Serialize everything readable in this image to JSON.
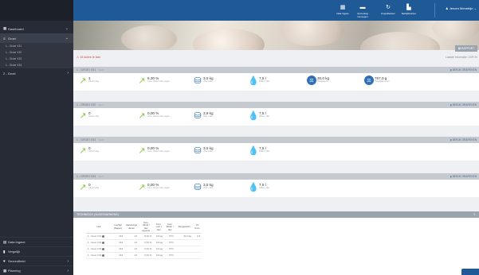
{
  "sidebar": {
    "main_items": [
      {
        "label": "Dashboard",
        "icon": "grid-icon"
      },
      {
        "label": "Groei",
        "icon": "list-icon"
      }
    ],
    "sub_items": [
      "1 - Groei V31",
      "1 - Groei V32",
      "1 - Groei V33",
      "1 - Groei V34"
    ],
    "after_items": [
      {
        "label": "2 - Groei"
      }
    ],
    "bottom_items": [
      {
        "label": "Data Ingave",
        "icon": "table-icon"
      },
      {
        "label": "Vergelijk",
        "icon": "chart-icon"
      },
      {
        "label": "Gezondheid",
        "icon": "heart-icon"
      },
      {
        "label": "Planning",
        "icon": "calendar-icon"
      }
    ]
  },
  "topbar": {
    "buttons": [
      {
        "label": "Data Ingave",
        "icon": "table-icon"
      },
      {
        "label": "Opmerking toevoegen",
        "icon": "comment-icon"
      },
      {
        "label": "Koppelbeheer",
        "icon": "refresh-icon"
      },
      {
        "label": "Bedrijfsbeheer",
        "icon": "building-icon"
      }
    ],
    "user": "Jeroen Menetrijn"
  },
  "rapport_label": "RAPPORT",
  "alert": "15 Acties te laat",
  "laatste": "Laatste informatie: 22/9 20",
  "groups": [
    {
      "title": "1 - GROEI V31",
      "tag": "Vak 8",
      "graf": "BEKIJK GRAFIEKEN",
      "kpis": [
        {
          "value": "1",
          "sub": "Uitval / dag"
        },
        {
          "value": "8,30 %",
          "sub": "Cum. Uitval / dier opgez."
        },
        {
          "value": "3,5 kg",
          "sub": "Voer / dier"
        },
        {
          "value": "7,5 l",
          "sub": "Water / dier"
        },
        {
          "value": "30,0 kg",
          "sub": "Diergewicht"
        },
        {
          "value": "767,0 g",
          "sub": "Dagelijkse groei"
        }
      ]
    },
    {
      "title": "1 - GROEI V32",
      "tag": "Vak 8",
      "graf": "BEKIJK GRAFIEKEN",
      "kpis": [
        {
          "value": "0",
          "sub": "Uitval / dag"
        },
        {
          "value": "0,00 %",
          "sub": "Cum. Uitval / dier opgez."
        },
        {
          "value": "3,9 kg",
          "sub": "Voer / dier"
        },
        {
          "value": "7,5 l",
          "sub": "Water / dier"
        }
      ]
    },
    {
      "title": "1 - GROEI V33",
      "tag": "Vak 8",
      "graf": "BEKIJK GRAFIEKEN",
      "kpis": [
        {
          "value": "0",
          "sub": "Uitval / dag"
        },
        {
          "value": "0,00 %",
          "sub": "Cum. Uitval / dier opgez."
        },
        {
          "value": "3,5 kg",
          "sub": "Voer / dier"
        },
        {
          "value": "7,5 l",
          "sub": "Water / dier"
        }
      ]
    },
    {
      "title": "1 - GROEI V34",
      "tag": "Vak 8",
      "graf": "BEKIJK GRAFIEKEN",
      "kpis": [
        {
          "value": "0",
          "sub": "Uitval / dag"
        },
        {
          "value": "0,00 %",
          "sub": "Cum. Uitval / dier opgez."
        },
        {
          "value": "3,5 kg",
          "sub": "Voer / dier"
        },
        {
          "value": "7,5 l",
          "sub": "Water / dier"
        }
      ]
    }
  ],
  "technisch": {
    "title": "TECHNISCH (VLEESVARKENS)",
    "headers": [
      "Hok",
      "Leeftijd (Dagen)",
      "Aanwezige dieren",
      "Cum. Uitval / dier opgezet",
      "Cum. voer / dier",
      "Cum. Water / dier",
      "Diergewicht",
      "VC Cum."
    ],
    "rows": [
      [
        "1 - Groei V31",
        "164",
        "12",
        "8,30 %",
        "174 kg",
        "373 l",
        "90,0 kg",
        "2,6"
      ],
      [
        "1 - Groei V32",
        "164",
        "12",
        "0,00 %",
        "174 kg",
        "373 l",
        "",
        ""
      ],
      [
        "1 - Groei V33",
        "164",
        "12",
        "0,00 %",
        "171 kg",
        "373 l",
        "",
        ""
      ],
      [
        "1 - Groei V34",
        "164",
        "12",
        "0,00 %",
        "174 kg",
        "373 l",
        "",
        ""
      ]
    ]
  }
}
